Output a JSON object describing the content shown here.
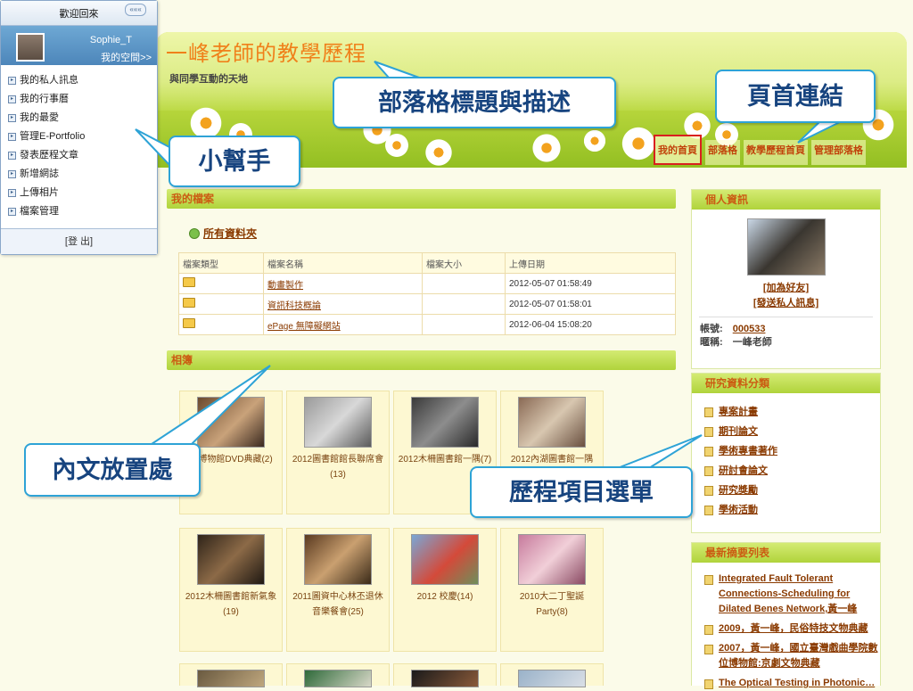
{
  "login_panel": {
    "title": "歡迎回來",
    "collapse_label": "«««",
    "user_name": "Sophie_T",
    "my_space": "我的空間>>",
    "menu": [
      "我的私人訊息",
      "我的行事曆",
      "我的最愛",
      "管理E-Portfolio",
      "發表歷程文章",
      "新增網誌",
      "上傳相片",
      "檔案管理"
    ],
    "logout": "[登 出]"
  },
  "header": {
    "title": "一峰老師的教學歷程",
    "description": "與同學互動的天地",
    "nav": [
      "我的首頁",
      "部落格",
      "教學歷程首頁",
      "管理部落格"
    ]
  },
  "files": {
    "heading": "我的檔案",
    "all_link": "所有資料夾",
    "columns": [
      "檔案類型",
      "檔案名稱",
      "檔案大小",
      "上傳日期"
    ],
    "rows": [
      {
        "name": "動畫製作",
        "size": "",
        "date": "2012-05-07 01:58:49"
      },
      {
        "name": "資訊科技概論",
        "size": "",
        "date": "2012-05-07 01:58:01"
      },
      {
        "name": "ePage 無障礙網站",
        "size": "",
        "date": "2012-06-04 15:08:20"
      }
    ]
  },
  "album": {
    "heading": "相簿",
    "items": [
      {
        "caption": "…博物館DVD典藏(2)"
      },
      {
        "caption": "2012圖書館館長聯席會(13)"
      },
      {
        "caption": "2012木柵圖書館一隅(7)"
      },
      {
        "caption": "2012內湖圖書館一隅"
      },
      {
        "caption": "2012木柵圖書館新氣象(19)"
      },
      {
        "caption": "2011圖資中心林丕退休音樂餐會(25)"
      },
      {
        "caption": "2012 校慶(14)"
      },
      {
        "caption": "2010大二丁聖誕Party(8)"
      }
    ]
  },
  "profile": {
    "heading": "個人資訊",
    "add_friend": "[加為好友]",
    "send_message": "[發送私人訊息]",
    "account_label": "帳號:",
    "account_value": "000533",
    "nickname_label": "暱稱:",
    "nickname_value": "一峰老師"
  },
  "research": {
    "heading": "研究資料分類",
    "items": [
      "專案計畫",
      "期刊論文",
      "學術專書著作",
      "研討會論文",
      "研究獎勵",
      "學術活動"
    ]
  },
  "awards": {
    "heading": "最新摘要列表",
    "items": [
      "Integrated Fault Tolerant Connections-Scheduling for Dilated Benes Network,黃一峰",
      "2009，黃一峰，民俗特技文物典藏",
      "2007，黃一峰，國立臺灣戲曲學院數位博物館:京劇文物典藏",
      "The Optical Testing in Photonic…"
    ]
  },
  "callouts": {
    "blog_title_desc": "部落格標題與描述",
    "homepage_links": "頁首連結",
    "helper": "小幫手",
    "content_area": "內文放置處",
    "portfolio_menu": "歷程項目選單"
  },
  "icons": {
    "collapse": "double-chevron-icon",
    "menu_bullet": "square-bullet-icon",
    "folder": "folder-icon",
    "all_files": "green-circle-icon",
    "list_item": "document-icon"
  },
  "colors": {
    "banner_green": "#b9d83f",
    "title_orange": "#f0801a",
    "section_text": "#cb5b12",
    "callout_border": "#2ea3d6",
    "callout_text": "#17447f",
    "active_nav_border": "#d9201f"
  }
}
